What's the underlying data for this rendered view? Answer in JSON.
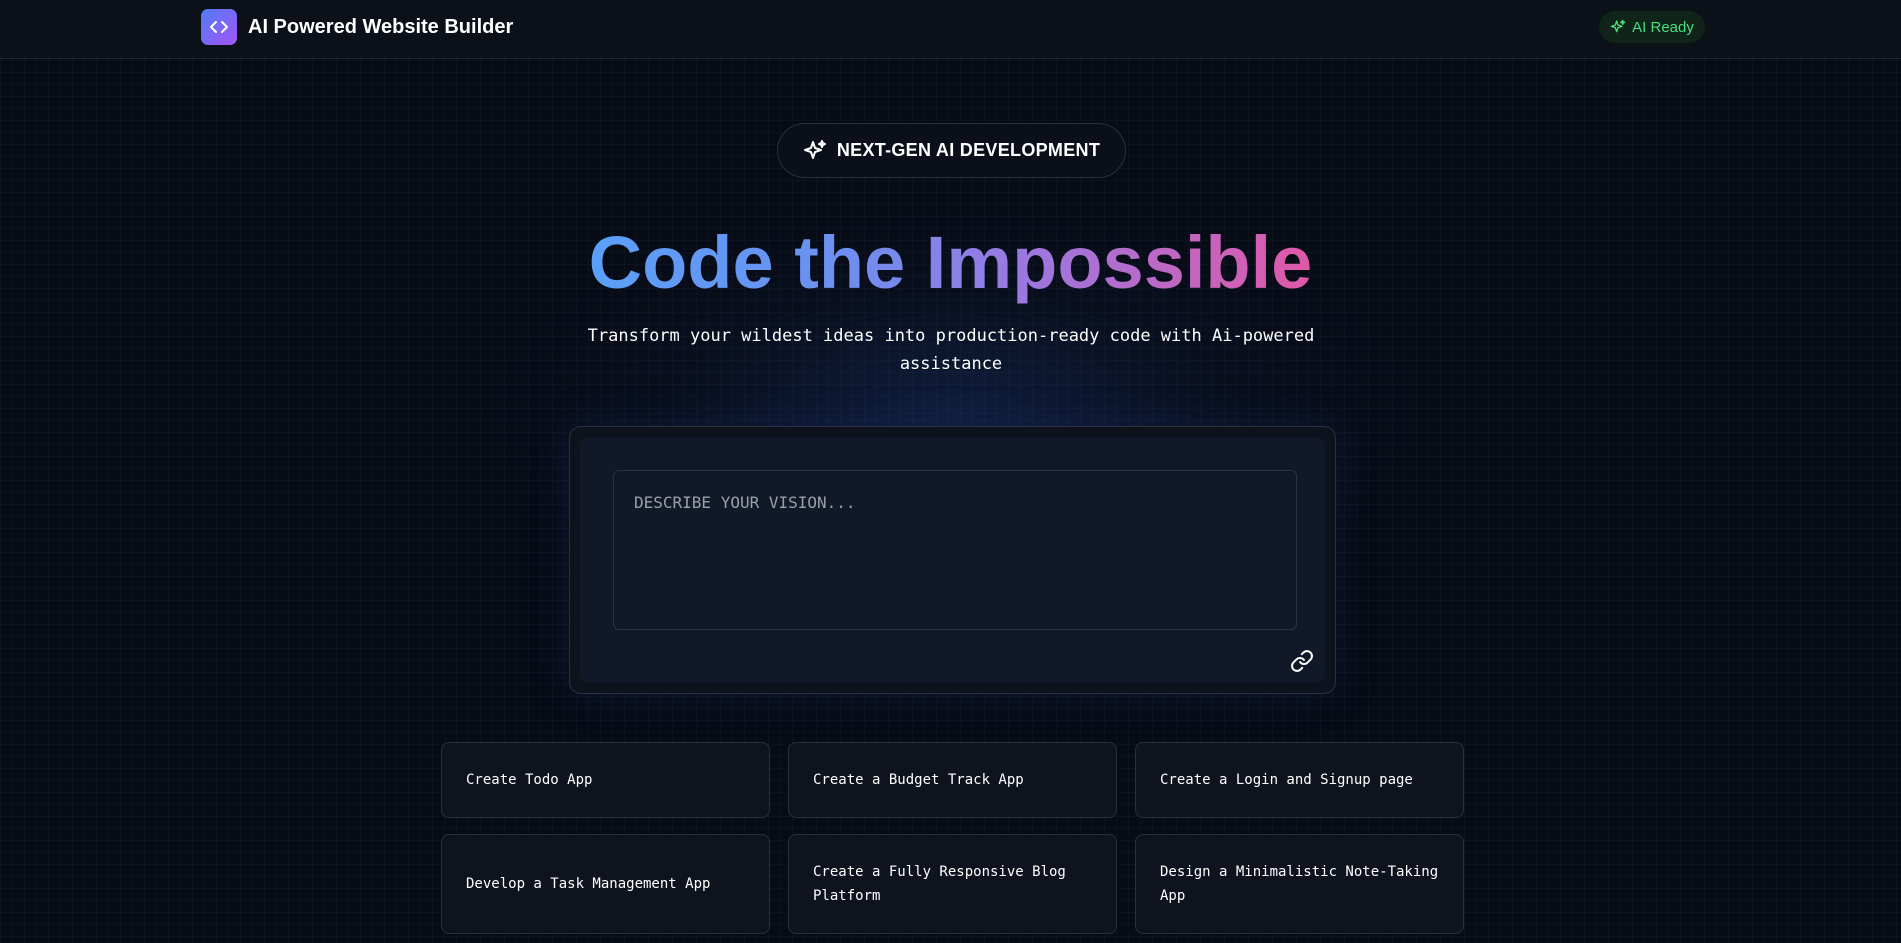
{
  "header": {
    "app_title": "AI Powered Website Builder",
    "logo_icon": "code-brackets-icon",
    "status_badge": "AI Ready",
    "status_icon": "sparkles-icon",
    "status_color": "#4ade80"
  },
  "hero": {
    "pill_label": "NEXT-GEN AI DEVELOPMENT",
    "pill_icon": "sparkles-icon",
    "title": "Code the Impossible",
    "subtitle": "Transform your wildest ideas into production-ready code with Ai-powered assistance"
  },
  "prompt": {
    "placeholder": "DESCRIBE YOUR VISION...",
    "value": "",
    "attach_icon": "link-icon"
  },
  "suggestions": [
    "Create Todo App",
    "Create a Budget Track App",
    "Create a Login and Signup page",
    "Develop a Task Management App",
    "Create a Fully Responsive Blog Platform",
    "Design a Minimalistic Note-Taking App"
  ],
  "colors": {
    "background": "#070b14",
    "accent_gradient_start": "#5aa0f8",
    "accent_gradient_end": "#e058a8",
    "logo_gradient_start": "#4f7cf7",
    "logo_gradient_end": "#a355f5"
  }
}
